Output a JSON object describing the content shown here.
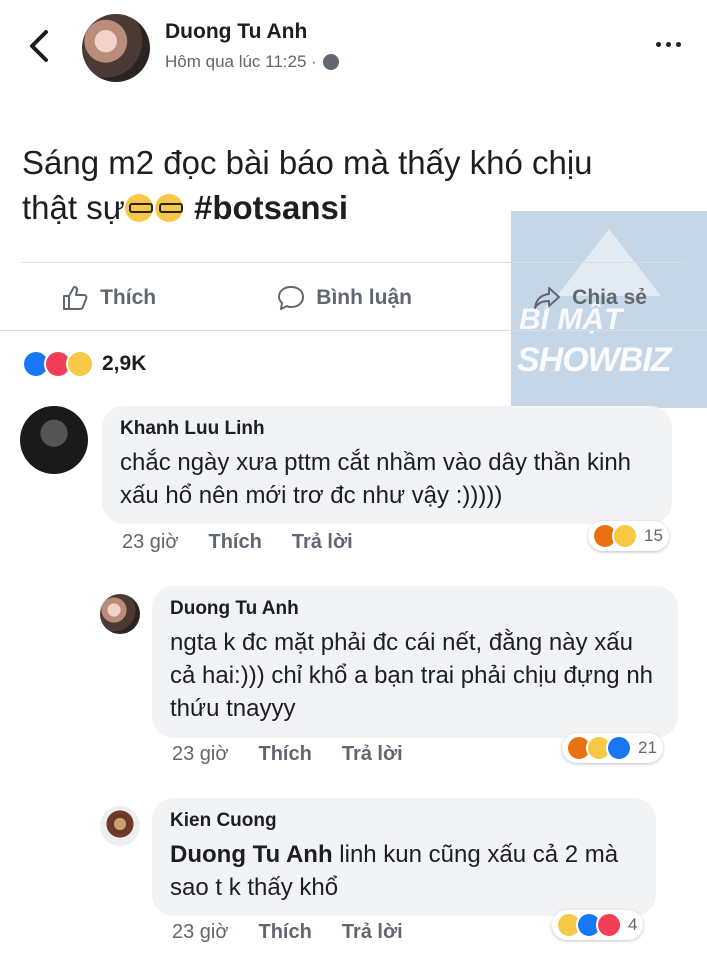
{
  "post": {
    "author": "Duong Tu Anh",
    "time": "Hôm qua lúc 11:25 ·",
    "text": "Sáng m2 đọc bài báo mà thấy khó chịu thật sự",
    "hashtag": "#botsansi"
  },
  "actions": {
    "like": "Thích",
    "comment": "Bình luận",
    "share": "Chia sẻ"
  },
  "reactions": {
    "count": "2,9K"
  },
  "watermark": {
    "line1": "BÍ MẬT",
    "line2": "SHOWBIZ"
  },
  "comments": [
    {
      "author": "Khanh Luu Linh",
      "text": "chắc ngày xưa pttm cắt nhầm vào dây thần kinh xấu hổ nên mới trơ đc như vậy :)))))",
      "time": "23 giờ",
      "like": "Thích",
      "reply": "Trả lời",
      "reaction_count": "15"
    },
    {
      "author": "Duong Tu Anh",
      "text": "ngta k đc mặt phải đc cái nết, đằng này xấu cả hai:))) chỉ khổ a bạn trai phải chịu đựng nh thứu tnayyy",
      "time": "23 giờ",
      "like": "Thích",
      "reply": "Trả lời",
      "reaction_count": "21"
    },
    {
      "author": "Kien Cuong",
      "mention": "Duong Tu Anh",
      "text": " linh kun cũng xấu cả 2 mà sao t k thấy khổ",
      "time": "23 giờ",
      "like": "Thích",
      "reply": "Trả lời",
      "reaction_count": "4"
    }
  ]
}
